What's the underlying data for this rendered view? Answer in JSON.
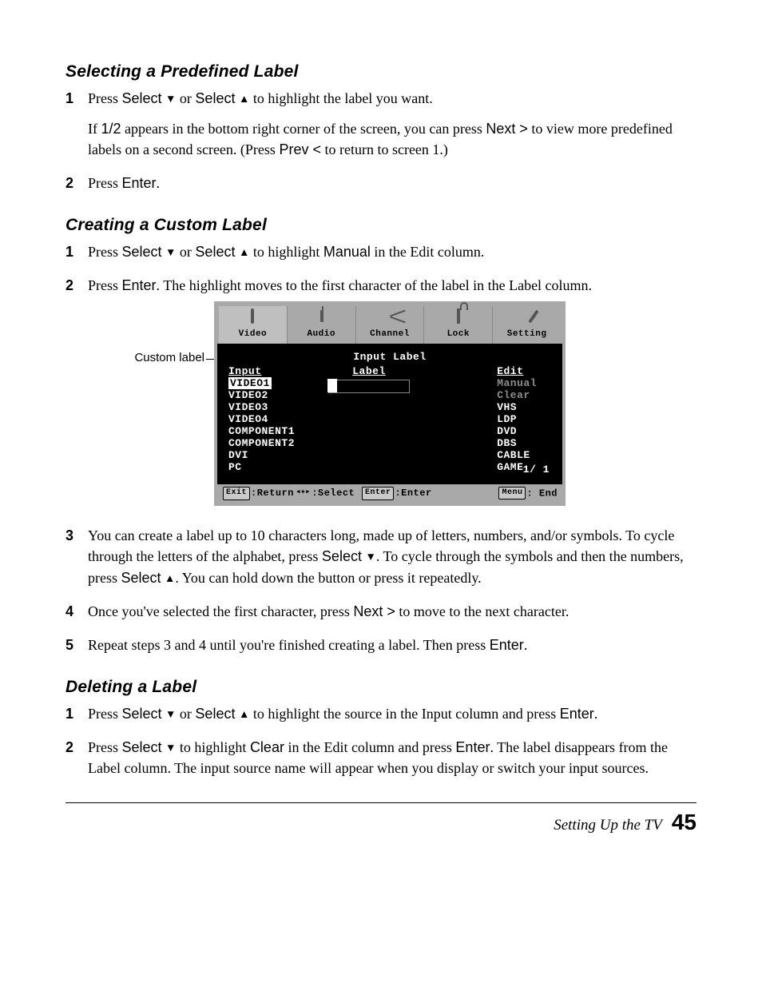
{
  "sections": {
    "s1": {
      "heading": "Selecting a Predefined Label",
      "step1_a": "Press ",
      "step1_b": "Select",
      "step1_c": " or ",
      "step1_d": "Select",
      "step1_e": " to highlight the label you want.",
      "step1_follow_a": "If ",
      "step1_follow_b": "1/2",
      "step1_follow_c": " appears in the bottom right corner of the screen, you can press ",
      "step1_follow_d": "Next >",
      "step1_follow_e": " to view more predefined labels on a second screen. (Press ",
      "step1_follow_f": "Prev <",
      "step1_follow_g": " to return to screen 1.)",
      "step2_a": "Press ",
      "step2_b": "Enter",
      "step2_c": "."
    },
    "s2": {
      "heading": "Creating a Custom Label",
      "step1_a": "Press ",
      "step1_b": "Select",
      "step1_c": " or ",
      "step1_d": "Select",
      "step1_e": " to highlight ",
      "step1_f": "Manual",
      "step1_g": " in the Edit column.",
      "step2_a": "Press ",
      "step2_b": "Enter",
      "step2_c": ". The highlight moves to the first character of the label in the Label column.",
      "step3_a": "You can create a label up to 10 characters long, made up of letters, numbers, and/or symbols. To cycle through the letters of the alphabet, press ",
      "step3_b": "Select",
      "step3_c": ". To cycle through the symbols and then the numbers, press ",
      "step3_d": "Select",
      "step3_e": ". You can hold down the button or press it repeatedly.",
      "step4_a": "Once you've selected the first character, press ",
      "step4_b": "Next >",
      "step4_c": " to move to the next character.",
      "step5_a": "Repeat steps 3 and 4 until you're finished creating a label. Then press ",
      "step5_b": "Enter",
      "step5_c": "."
    },
    "s3": {
      "heading": "Deleting a Label",
      "step1_a": "Press ",
      "step1_b": "Select",
      "step1_c": " or ",
      "step1_d": "Select",
      "step1_e": " to highlight the source in the Input column and press ",
      "step1_f": "Enter",
      "step1_g": ".",
      "step2_a": "Press ",
      "step2_b": "Select",
      "step2_c": " to highlight ",
      "step2_d": "Clear",
      "step2_e": " in the Edit column and press ",
      "step2_f": "Enter",
      "step2_g": ". The label disappears from the Label column. The input source name will appear when you display or switch your input sources."
    }
  },
  "callout": "Custom label",
  "osd": {
    "tabs": [
      "Video",
      "Audio",
      "Channel",
      "Lock",
      "Setting"
    ],
    "title": "Input Label",
    "colInput_hdr": "Input",
    "colInput": [
      "VIDEO1",
      "VIDEO2",
      "VIDEO3",
      "VIDEO4",
      "COMPONENT1",
      "COMPONENT2",
      "DVI",
      "PC"
    ],
    "colLabel_hdr": "Label",
    "colEdit_hdr": "Edit",
    "colEdit": [
      "Manual",
      "Clear",
      "VHS",
      "LDP",
      "DVD",
      "DBS",
      "CABLE",
      "GAME"
    ],
    "pageInd": "1/ 1",
    "footer": {
      "exit": "Exit",
      "return": ":Return",
      "select": ":Select",
      "enterKey": "Enter",
      "enter": ":Enter",
      "menuKey": "Menu",
      "end": ": End"
    }
  },
  "footer": {
    "section": "Setting Up the TV",
    "page": "45"
  },
  "glyphs": {
    "down": "▼",
    "up": "▲"
  }
}
